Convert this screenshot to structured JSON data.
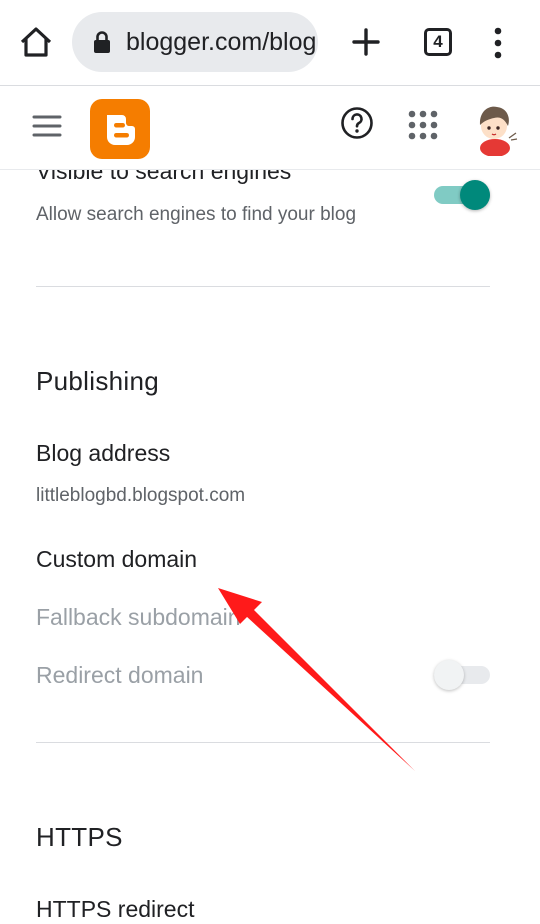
{
  "browser": {
    "url_text": "blogger.com/blog",
    "tab_count": "4"
  },
  "header": {
    "logo_icon": "blogger-logo-icon",
    "help_icon": "help-circle-icon",
    "apps_icon": "apps-grid-icon",
    "avatar_icon": "user-avatar"
  },
  "settings": {
    "search_engines": {
      "title": "Visible to search engines",
      "description": "Allow search engines to find your blog",
      "enabled": true
    },
    "publishing": {
      "heading": "Publishing",
      "blog_address_title": "Blog address",
      "blog_address_value": "littleblogbd.blogspot.com",
      "custom_domain_title": "Custom domain",
      "fallback_subdomain_title": "Fallback subdomain",
      "redirect_domain_title": "Redirect domain",
      "redirect_enabled": false
    },
    "https": {
      "heading": "HTTPS",
      "redirect_title": "HTTPS redirect"
    }
  },
  "colors": {
    "accent": "#00897b",
    "blogger_orange": "#f57d00",
    "annotation_red": "#ff1a1a"
  }
}
